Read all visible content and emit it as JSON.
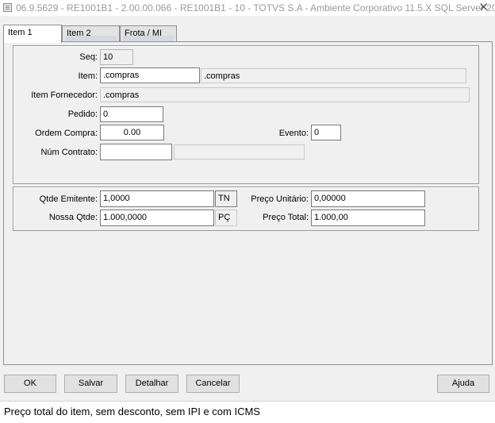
{
  "window": {
    "title": "06.9.5629 - RE1001B1 - 2.00.00.066 - RE1001B1 - 10 - TOTVS S.A - Ambiente Corporativo 11.5.X SQL Server 20..."
  },
  "tabs": [
    {
      "label": "Item 1",
      "active": true
    },
    {
      "label": "Item 2",
      "active": false
    },
    {
      "label": "Frota / MI",
      "active": false
    }
  ],
  "item_group": {
    "seq_label": "Seq:",
    "seq_value": "10",
    "item_label": "Item:",
    "item_value": ".compras",
    "item_desc": ".compras",
    "item_fornecedor_label": "Item Fornecedor:",
    "item_fornecedor_value": ".compras",
    "pedido_label": "Pedido:",
    "pedido_value": "0",
    "ordem_compra_label": "Ordem Compra:",
    "ordem_compra_value": "0.00",
    "evento_label": "Evento:",
    "evento_value": "0",
    "num_contrato_label": "Núm Contrato:",
    "num_contrato_value": "",
    "num_contrato_desc": ""
  },
  "qty_group": {
    "qtde_emitente_label": "Qtde Emitente:",
    "qtde_emitente_value": "1,0000",
    "qtde_emitente_unit": "TN",
    "nossa_qtde_label": "Nossa Qtde:",
    "nossa_qtde_value": "1.000,0000",
    "nossa_qtde_unit": "PÇ",
    "preco_unitario_label": "Preço Unitário:",
    "preco_unitario_value": "0,00000",
    "preco_total_label": "Preço Total:",
    "preco_total_value": "1.000,00"
  },
  "buttons": {
    "ok": "OK",
    "salvar": "Salvar",
    "detalhar": "Detalhar",
    "cancelar": "Cancelar",
    "ajuda": "Ajuda"
  },
  "status": {
    "text": "Preço total do item, sem desconto, sem IPI e com ICMS"
  }
}
